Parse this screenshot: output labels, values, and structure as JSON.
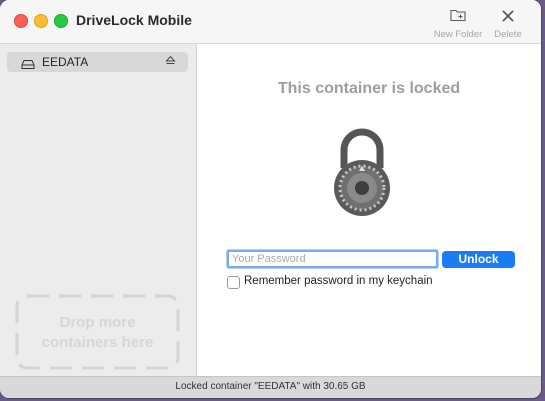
{
  "window": {
    "title": "DriveLock Mobile"
  },
  "toolbar": {
    "new_folder_label": "New Folder",
    "delete_label": "Delete"
  },
  "sidebar": {
    "items": [
      {
        "label": "EEDATA",
        "icon": "drive-icon",
        "action_icon": "eject-icon"
      }
    ],
    "dropzone_line1": "Drop more",
    "dropzone_line2": "containers here"
  },
  "main": {
    "heading": "This container is locked",
    "lock_icon": "combination-padlock-icon",
    "password": {
      "value": "",
      "placeholder": "Your Password"
    },
    "unlock_label": "Unlock",
    "remember": {
      "label": "Remember password in my keychain",
      "checked": false
    }
  },
  "status": {
    "text": "Locked container \"EEDATA\" with 30.65 GB"
  },
  "colors": {
    "accent": "#1a7cf5",
    "traffic_red": "#fe5f57",
    "traffic_yellow": "#febc2e",
    "traffic_green": "#28c840"
  }
}
